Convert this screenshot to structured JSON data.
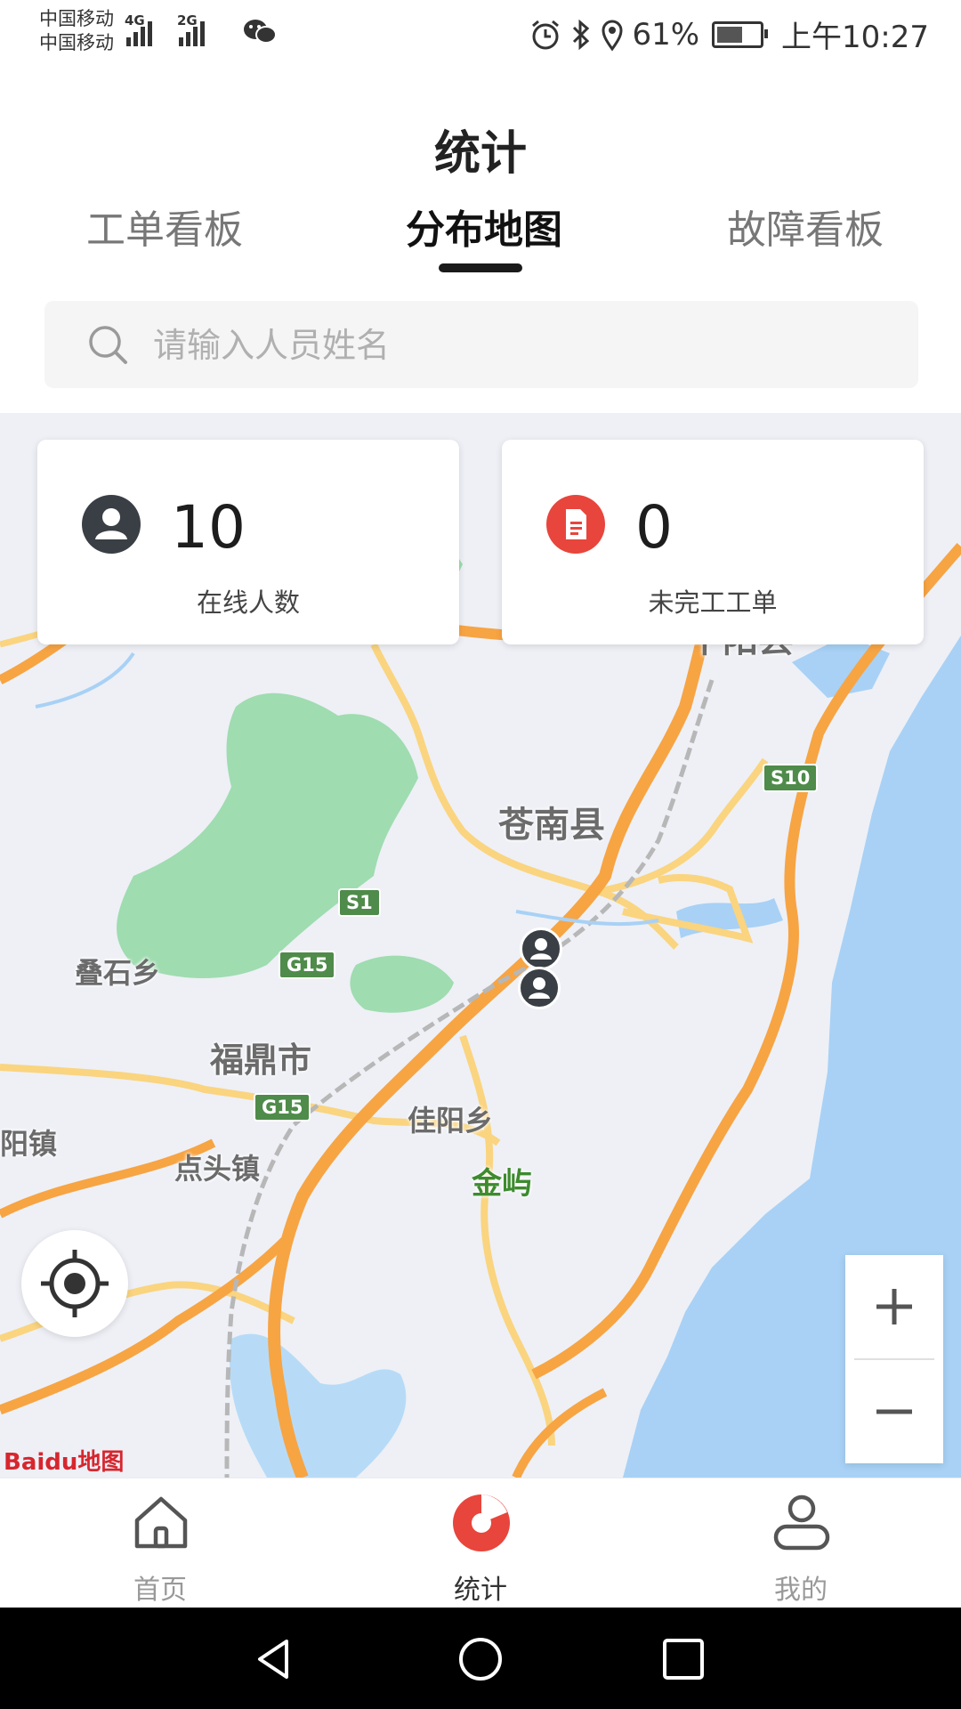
{
  "status_bar": {
    "carrier_1": "中国移动",
    "carrier_2": "中国移动",
    "network_1": "4G",
    "network_2": "2G",
    "battery_text": "61%",
    "battery_level": 0.61,
    "time": "上午10:27"
  },
  "header": {
    "title": "统计",
    "tabs": [
      {
        "label": "工单看板",
        "active": false
      },
      {
        "label": "分布地图",
        "active": true
      },
      {
        "label": "故障看板",
        "active": false
      }
    ]
  },
  "search": {
    "placeholder": "请输入人员姓名",
    "value": ""
  },
  "cards": [
    {
      "value": "10",
      "label": "在线人数",
      "icon": "person-icon",
      "icon_color": "#3a3f45"
    },
    {
      "value": "0",
      "label": "未完工工单",
      "icon": "document-icon",
      "icon_color": "#e8453c"
    }
  ],
  "map": {
    "places": {
      "pingyang": "平阳县",
      "cangnan": "苍南县",
      "dieshi": "叠石乡",
      "fuding": "福鼎市",
      "jiayang": "佳阳乡",
      "diantou": "点头镇",
      "jinyu": "金屿",
      "left_town": "阳镇"
    },
    "roads": {
      "s1": "S1",
      "s10": "S10",
      "g15": "G15"
    },
    "colors": {
      "land": "#eef0f6",
      "water": "#a8d1f5",
      "green": "#9fdcb0",
      "highway": "#f7a443",
      "road": "#fad47f"
    },
    "logo_text": "Baidu地图"
  },
  "zoom": {
    "plus": "+",
    "minus": "−"
  },
  "bottom_nav": [
    {
      "label": "首页",
      "icon": "home-icon",
      "active": false
    },
    {
      "label": "统计",
      "icon": "pie-chart-icon",
      "active": true
    },
    {
      "label": "我的",
      "icon": "profile-icon",
      "active": false
    }
  ],
  "colors": {
    "accent": "#e8453c",
    "tab_active": "#1a1a1a"
  }
}
